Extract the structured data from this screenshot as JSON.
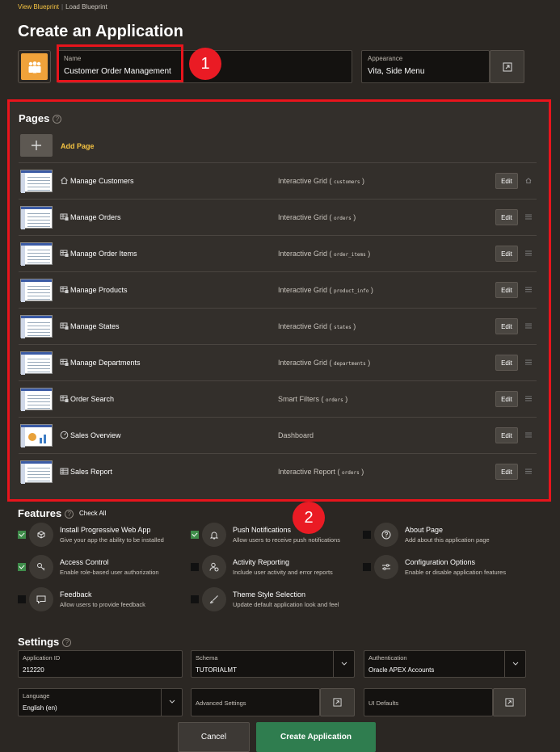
{
  "breadcrumbs": {
    "active": "View Blueprint",
    "next": "Load Blueprint"
  },
  "title": "Create an Application",
  "name_field": {
    "label": "Name",
    "value": "Customer Order Management"
  },
  "appearance_field": {
    "label": "Appearance",
    "value": "Vita, Side Menu"
  },
  "callouts": {
    "one": "1",
    "two": "2"
  },
  "pages": {
    "title": "Pages",
    "add_page": "Add Page",
    "edit_label": "Edit",
    "items": [
      {
        "name": "Manage Customers",
        "type": "Interactive Grid",
        "source": "customers",
        "icon": "home-icon"
      },
      {
        "name": "Manage Orders",
        "type": "Interactive Grid",
        "source": "orders",
        "icon": "grid-icon"
      },
      {
        "name": "Manage Order Items",
        "type": "Interactive Grid",
        "source": "order_items",
        "icon": "grid-icon"
      },
      {
        "name": "Manage Products",
        "type": "Interactive Grid",
        "source": "product_info",
        "icon": "grid-icon"
      },
      {
        "name": "Manage States",
        "type": "Interactive Grid",
        "source": "states",
        "icon": "grid-icon"
      },
      {
        "name": "Manage Departments",
        "type": "Interactive Grid",
        "source": "departments",
        "icon": "grid-icon"
      },
      {
        "name": "Order Search",
        "type": "Smart Filters",
        "source": "orders",
        "icon": "grid-icon"
      },
      {
        "name": "Sales Overview",
        "type": "Dashboard",
        "source": "",
        "icon": "dashboard-icon"
      },
      {
        "name": "Sales Report",
        "type": "Interactive Report",
        "source": "orders",
        "icon": "report-icon"
      }
    ]
  },
  "features": {
    "title": "Features",
    "check_all": "Check All",
    "items": [
      {
        "title": "Install Progressive Web App",
        "desc": "Give your app the ability to be installed",
        "checked": true,
        "icon": "pwa-icon"
      },
      {
        "title": "Push Notifications",
        "desc": "Allow users to receive push notifications",
        "checked": true,
        "icon": "bell-icon"
      },
      {
        "title": "About Page",
        "desc": "Add about this application page",
        "checked": false,
        "icon": "question-icon"
      },
      {
        "title": "Access Control",
        "desc": "Enable role-based user authorization",
        "checked": true,
        "icon": "key-icon"
      },
      {
        "title": "Activity Reporting",
        "desc": "Include user activity and error reports",
        "checked": false,
        "icon": "user-activity-icon"
      },
      {
        "title": "Configuration Options",
        "desc": "Enable or disable application features",
        "checked": false,
        "icon": "sliders-icon"
      },
      {
        "title": "Feedback",
        "desc": "Allow users to provide feedback",
        "checked": false,
        "icon": "chat-icon"
      },
      {
        "title": "Theme Style Selection",
        "desc": "Update default application look and feel",
        "checked": false,
        "icon": "brush-icon"
      }
    ]
  },
  "settings": {
    "title": "Settings",
    "application_id": {
      "label": "Application ID",
      "value": "212220"
    },
    "schema": {
      "label": "Schema",
      "value": "TUTORIALMT"
    },
    "authentication": {
      "label": "Authentication",
      "value": "Oracle APEX Accounts"
    },
    "language": {
      "label": "Language",
      "value": "English (en)"
    },
    "advanced": {
      "label": "Advanced Settings"
    },
    "ui_defaults": {
      "label": "UI Defaults"
    }
  },
  "footer": {
    "cancel": "Cancel",
    "create": "Create Application"
  },
  "colors": {
    "accent": "#f5c342",
    "primary_button": "#2f7d4f",
    "callout": "#e8141c"
  }
}
